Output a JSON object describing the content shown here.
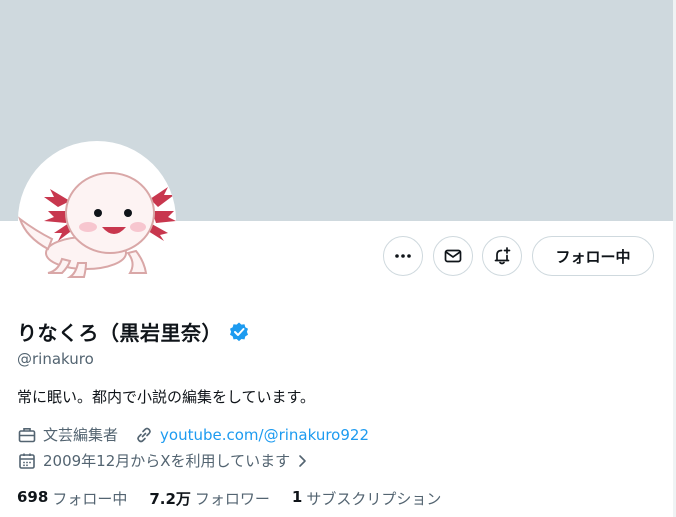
{
  "profile": {
    "display_name": "りなくろ（黒岩里奈）",
    "handle": "@rinakuro",
    "bio": "常に眠い。都内で小説の編集をしています。",
    "category": "文芸編集者",
    "link_text": "youtube.com/@rinakuro922",
    "joined": "2009年12月からXを利用しています",
    "verified": true
  },
  "actions": {
    "more_icon": "more-horizontal-icon",
    "message_icon": "envelope-icon",
    "notify_icon": "bell-plus-icon",
    "follow_label": "フォロー中"
  },
  "stats": [
    {
      "value": "698",
      "label": "フォロー中"
    },
    {
      "value": "7.2万",
      "label": "フォロワー"
    },
    {
      "value": "1",
      "label": "サブスクリプション"
    }
  ],
  "colors": {
    "banner": "#cfd9de",
    "accent": "#1d9bf0",
    "secondary_text": "#536471",
    "primary_text": "#0f1419"
  }
}
